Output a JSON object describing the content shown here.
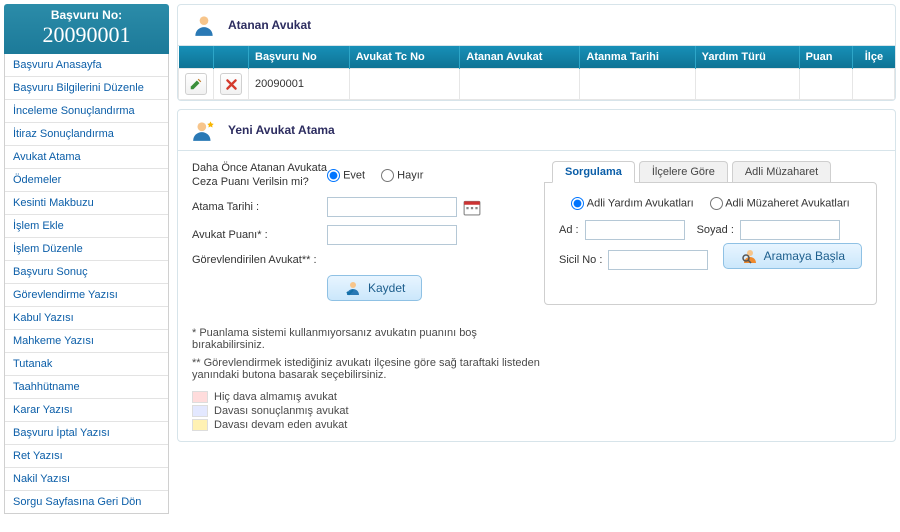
{
  "sidebar": {
    "head_label": "Başvuru No:",
    "head_value": "20090001",
    "items": [
      {
        "label": "Başvuru Anasayfa"
      },
      {
        "label": "Başvuru Bilgilerini Düzenle"
      },
      {
        "label": "İnceleme Sonuçlandırma"
      },
      {
        "label": "İtiraz Sonuçlandırma"
      },
      {
        "label": "Avukat Atama"
      },
      {
        "label": "Ödemeler"
      },
      {
        "label": "Kesinti Makbuzu"
      },
      {
        "label": "İşlem Ekle"
      },
      {
        "label": "İşlem Düzenle"
      },
      {
        "label": "Başvuru Sonuç"
      },
      {
        "label": "Görevlendirme Yazısı"
      },
      {
        "label": "Kabul Yazısı"
      },
      {
        "label": "Mahkeme Yazısı"
      },
      {
        "label": "Tutanak"
      },
      {
        "label": "Taahhütname"
      },
      {
        "label": "Karar Yazısı"
      },
      {
        "label": "Başvuru İptal Yazısı"
      },
      {
        "label": "Ret Yazısı"
      },
      {
        "label": "Nakil Yazısı"
      },
      {
        "label": "Sorgu Sayfasına Geri Dön"
      }
    ]
  },
  "panel_assigned": {
    "title": "Atanan Avukat",
    "columns": [
      "",
      "",
      "Başvuru No",
      "Avukat Tc No",
      "Atanan Avukat",
      "Atanma Tarihi",
      "Yardım Türü",
      "Puan",
      "İlçe"
    ],
    "rows": [
      {
        "basvuru_no": "20090001",
        "tc": "",
        "avukat": "",
        "tarih": "",
        "tur": "",
        "puan": "",
        "ilce": ""
      }
    ]
  },
  "panel_assign": {
    "title": "Yeni Avukat Atama",
    "q_penalty": "Daha Önce Atanan Avukata Ceza Puanı Verilsin mi?",
    "opt_yes": "Evet",
    "opt_no": "Hayır",
    "lbl_date": "Atama Tarihi :",
    "lbl_score": "Avukat Puanı* :",
    "lbl_assigned": "Görevlendirilen Avukat** :",
    "btn_save": "Kaydet",
    "note1": "* Puanlama sistemi kullanmıyorsanız avukatın puanını boş bırakabilirsiniz.",
    "note2": "** Görevlendirmek istediğiniz avukatı ilçesine göre sağ taraftaki listeden yanındaki butona basarak seçebilirsiniz.",
    "legend": [
      {
        "color": "#ffdcdc",
        "text": "Hiç dava almamış avukat"
      },
      {
        "color": "#e3e8ff",
        "text": "Davası sonuçlanmış avukat"
      },
      {
        "color": "#fff1b3",
        "text": "Davası devam eden avukat"
      }
    ],
    "tabs": {
      "t1": "Sorgulama",
      "t2": "İlçelere Göre",
      "t3": "Adli Müzaharet",
      "r1": "Adli Yardım Avukatları",
      "r2": "Adli Müzaheret Avukatları",
      "lbl_ad": "Ad :",
      "lbl_soyad": "Soyad :",
      "lbl_sicil": "Sicil No :",
      "btn_search": "Aramaya Başla"
    }
  }
}
